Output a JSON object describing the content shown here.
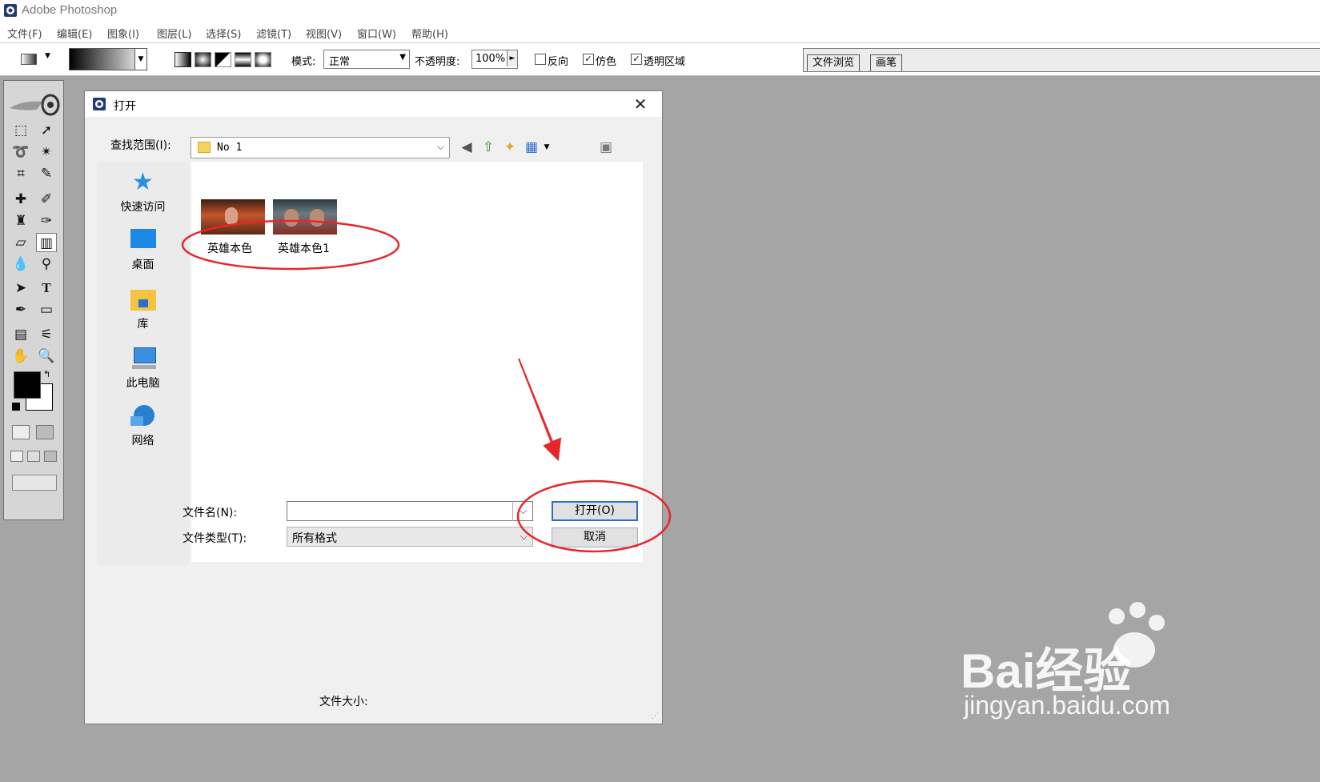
{
  "app": {
    "title": "Adobe Photoshop"
  },
  "menu": [
    "文件(F)",
    "编辑(E)",
    "图象(I)",
    "图层(L)",
    "选择(S)",
    "滤镜(T)",
    "视图(V)",
    "窗口(W)",
    "帮助(H)"
  ],
  "options": {
    "mode_label": "模式:",
    "mode_value": "正常",
    "opacity_label": "不透明度:",
    "opacity_value": "100%",
    "reverse_label": "反向",
    "dither_label": "仿色",
    "transparency_label": "透明区域",
    "reverse_checked": false,
    "dither_checked": true,
    "transparency_checked": true
  },
  "palette_tabs": [
    "文件浏览",
    "画笔"
  ],
  "dialog": {
    "title": "打开",
    "look_in_label": "查找范围(I):",
    "look_in_value": "No 1",
    "places": [
      "快速访问",
      "桌面",
      "库",
      "此电脑",
      "网络"
    ],
    "files": [
      {
        "name": "英雄本色"
      },
      {
        "name": "英雄本色1"
      }
    ],
    "filename_label": "文件名(N):",
    "filename_value": "",
    "filetype_label": "文件类型(T):",
    "filetype_value": "所有格式",
    "open_button": "打开(O)",
    "cancel_button": "取消",
    "filesize_label": "文件大小:"
  },
  "watermark": {
    "brand": "Bai经验",
    "url": "jingyan.baidu.com"
  },
  "colors": {
    "annotation": "#e8262a",
    "accent": "#2a6fd0",
    "workspace": "#a5a5a5"
  }
}
